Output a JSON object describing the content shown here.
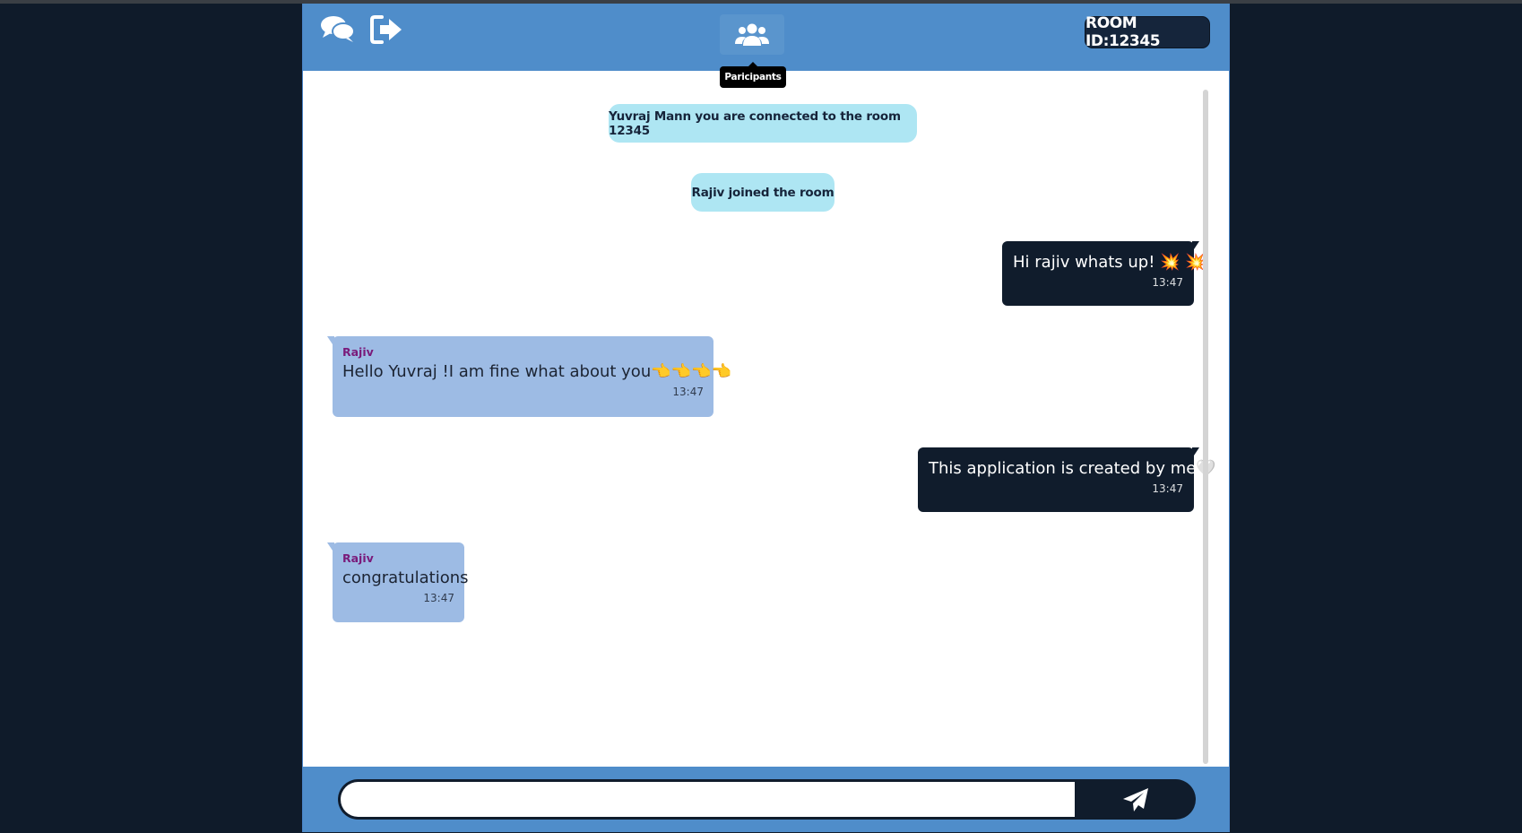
{
  "header": {
    "chat_icon": "chat-bubbles-icon",
    "exit_icon": "sign-out-icon",
    "participants_icon": "users-icon",
    "participants_tooltip": "Paricipants",
    "room_id_label": "ROOM ID:12345"
  },
  "messages": {
    "system": [
      {
        "text": "Yuvraj Mann you are connected to the room 12345"
      },
      {
        "text": "Rajiv joined the room"
      }
    ],
    "outgoing": [
      {
        "text": "Hi rajiv whats up! 💥 💥",
        "time": "13:47"
      },
      {
        "text": "This application is created by me🤍",
        "time": "13:47"
      }
    ],
    "incoming": [
      {
        "sender": "Rajiv",
        "text": "Hello Yuvraj !I am fine what about you👈👈👈👈",
        "time": "13:47"
      },
      {
        "sender": "Rajiv",
        "text": "congratulations",
        "time": "13:47"
      }
    ]
  },
  "composer": {
    "placeholder": "",
    "value": "",
    "send_icon": "paper-plane-icon"
  },
  "colors": {
    "page_bg": "#0f1b2a",
    "header_bg": "#4f8dca",
    "badge_bg": "#15253b",
    "system_bubble": "#aee6f3",
    "outgoing_bubble": "#101c2c",
    "incoming_bubble": "#9dbbe4",
    "sender_name": "#7a1a7a"
  }
}
